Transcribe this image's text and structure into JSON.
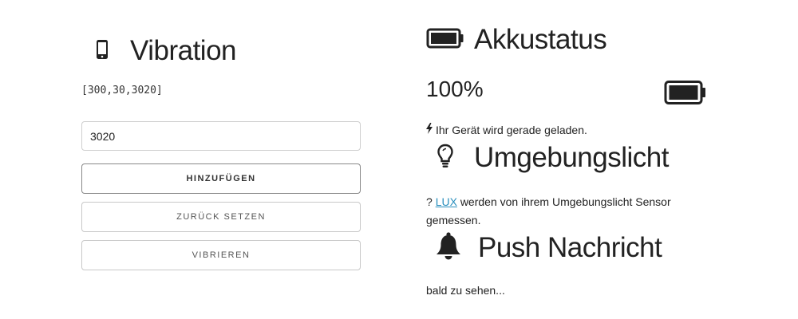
{
  "vibration": {
    "title": "Vibration",
    "icon": "phone-icon",
    "pattern": "[300,30,3020]",
    "input_value": "3020",
    "buttons": {
      "add": "HINZUFÜGEN",
      "reset": "ZURÜCK SETZEN",
      "vibrate": "VIBRIEREN"
    }
  },
  "battery": {
    "title": "Akkustatus",
    "icon": "battery-full-icon",
    "level": "100%",
    "level_value": 1.0,
    "charging_text": "Ihr Gerät wird gerade geladen.",
    "charging_icon": "bolt-icon"
  },
  "ambient_light": {
    "title": "Umgebungslicht",
    "icon": "lightbulb-icon",
    "value": "?",
    "unit_link": "LUX",
    "description": "werden von ihrem Umgebungslicht Sensor gemessen."
  },
  "push": {
    "title": "Push Nachricht",
    "icon": "bell-icon",
    "text": "bald zu sehen..."
  },
  "colors": {
    "link": "#2a8fbd",
    "text": "#222222",
    "border": "#c8c8c8"
  }
}
